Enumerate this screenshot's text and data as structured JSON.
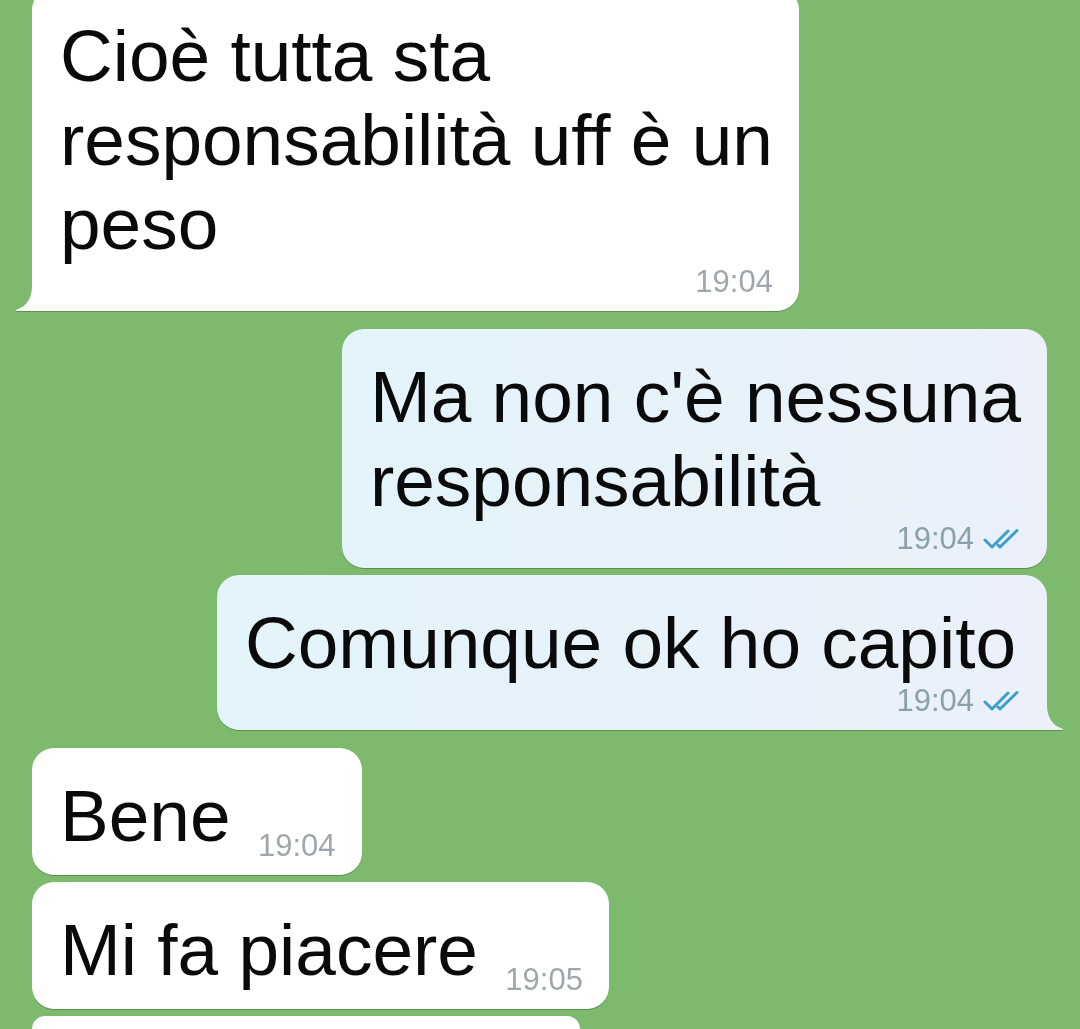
{
  "chat": {
    "messages": [
      {
        "kind": "incoming",
        "text": "Cioè tutta sta\nresponsabilità uff è un\npeso",
        "time": "19:04",
        "tail": true
      },
      {
        "kind": "outgoing",
        "text": "Ma non c'è nessuna\nresponsabilità",
        "time": "19:04",
        "read": true,
        "tail": false
      },
      {
        "kind": "outgoing",
        "text": "Comunque ok ho capito",
        "time": "19:04",
        "read": true,
        "tail": true
      },
      {
        "kind": "incoming",
        "text": "Bene",
        "time": "19:04",
        "tail": false
      },
      {
        "kind": "incoming",
        "text": "Mi fa piacere",
        "time": "19:05",
        "tail": false
      },
      {
        "kind": "incoming"
      }
    ]
  }
}
